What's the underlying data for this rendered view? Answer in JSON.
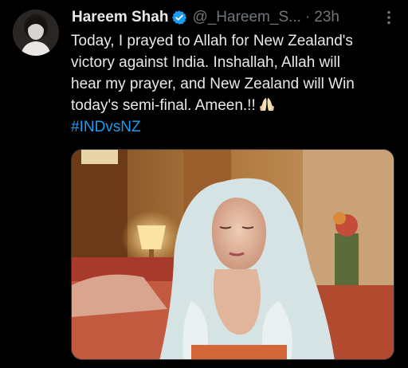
{
  "author": {
    "display_name": "Hareem Shah",
    "handle": "@_Hareem_S...",
    "separator": "·",
    "time": "23h",
    "verified_badge_color": "#1d9bf0"
  },
  "tweet": {
    "lines": [
      "Today, I prayed to Allah for New Zealand's",
      "victory against India. Inshallah, Allah will",
      "hear my prayer, and New Zealand will Win",
      "today's semi-final. Ameen.!!"
    ],
    "emoji": "folded-hands-emoji",
    "hashtag": "#INDvsNZ",
    "hashtag_color": "#1d9bf0"
  },
  "icons": {
    "more": "more-options-icon",
    "verified": "verified-badge-icon"
  }
}
